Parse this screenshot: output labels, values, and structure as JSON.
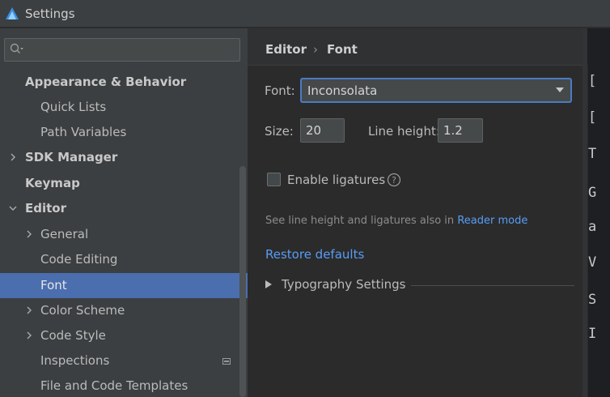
{
  "window": {
    "title": "Settings"
  },
  "sidebar": {
    "search": {
      "placeholder": ""
    },
    "items": [
      {
        "label": "Appearance & Behavior"
      },
      {
        "label": "Quick Lists"
      },
      {
        "label": "Path Variables"
      },
      {
        "label": "SDK Manager"
      },
      {
        "label": "Keymap"
      },
      {
        "label": "Editor"
      },
      {
        "label": "General"
      },
      {
        "label": "Code Editing"
      },
      {
        "label": "Font"
      },
      {
        "label": "Color Scheme"
      },
      {
        "label": "Code Style"
      },
      {
        "label": "Inspections"
      },
      {
        "label": "File and Code Templates"
      }
    ],
    "selected": "Font"
  },
  "breadcrumb": {
    "parent": "Editor",
    "separator": "›",
    "current": "Font"
  },
  "font_panel": {
    "font_label": "Font:",
    "font_value": "Inconsolata",
    "size_label": "Size:",
    "size_value": "20",
    "line_height_label": "Line height:",
    "line_height_value": "1.2",
    "ligatures_label": "Enable ligatures",
    "ligatures_checked": false,
    "note_text": "See line height and ligatures also in",
    "note_link": "Reader mode",
    "restore_label": "Restore defaults",
    "typography_label": "Typography Settings"
  },
  "preview": {
    "lines": [
      "[",
      "[",
      "T",
      "G",
      "a",
      "V",
      "S",
      "I"
    ]
  },
  "colors": {
    "accent": "#4b6eaf",
    "link": "#589df6",
    "focus": "#4a7bc4"
  },
  "icons": [
    "app-logo-icon",
    "search-icon",
    "chevron-right-icon",
    "chevron-down-icon",
    "project-scope-icon",
    "dropdown-arrow-icon",
    "help-icon",
    "triangle-right-icon"
  ]
}
